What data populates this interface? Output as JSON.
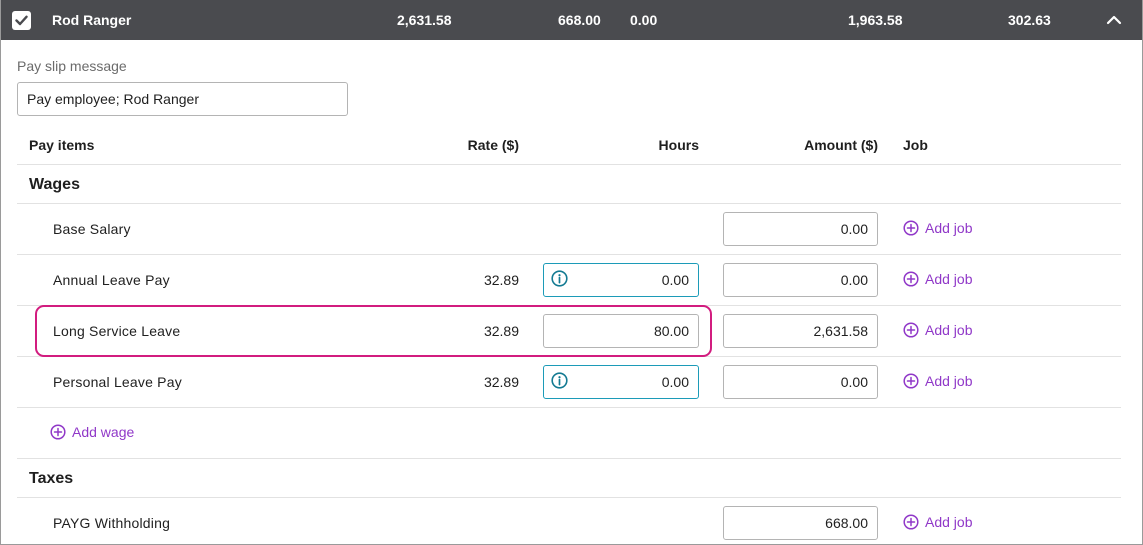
{
  "employee": {
    "name": "Rod Ranger",
    "totals": [
      "2,631.58",
      "668.00",
      "0.00",
      "1,963.58",
      "302.63"
    ],
    "checkbox": "checked",
    "colors": {
      "header_bg": "#4a4b4f",
      "accent_purple": "#9038c8",
      "highlight": "#d21c7f",
      "info_border": "#1c9bb8"
    }
  },
  "payslip": {
    "label": "Pay slip message",
    "value": "Pay employee; Rod Ranger"
  },
  "table": {
    "headers": {
      "pay_items": "Pay items",
      "rate": "Rate ($)",
      "hours": "Hours",
      "amount": "Amount ($)",
      "job": "Job"
    }
  },
  "wages": {
    "title": "Wages",
    "rows": [
      {
        "label": "Base Salary",
        "rate": "",
        "hours": "",
        "amount": "0.00",
        "job": "Add job"
      },
      {
        "label": "Annual Leave Pay",
        "rate": "32.89",
        "hours": "0.00",
        "amount": "0.00",
        "job": "Add job"
      },
      {
        "label": "Long Service Leave",
        "rate": "32.89",
        "hours": "80.00",
        "amount": "2,631.58",
        "job": "Add job"
      },
      {
        "label": "Personal Leave Pay",
        "rate": "32.89",
        "hours": "0.00",
        "amount": "0.00",
        "job": "Add job"
      }
    ],
    "add_label": "Add wage"
  },
  "taxes": {
    "title": "Taxes",
    "rows": [
      {
        "label": "PAYG Withholding",
        "amount": "668.00",
        "job": "Add job"
      }
    ]
  }
}
